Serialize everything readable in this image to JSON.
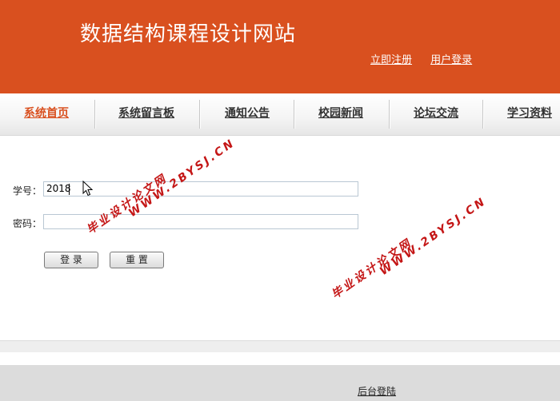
{
  "header": {
    "title": "数据结构课程设计网站",
    "links": [
      "立即注册",
      "用户登录"
    ]
  },
  "nav": {
    "items": [
      "系统首页",
      "系统留言板",
      "通知公告",
      "校园新闻",
      "论坛交流",
      "学习资料"
    ],
    "active_index": 0
  },
  "login_form": {
    "student_id_label": "学号：",
    "student_id_value": "2018",
    "password_label": "密码：",
    "password_value": "",
    "login_button": "登 录",
    "reset_button": "重 置"
  },
  "footer": {
    "admin_login_link": "后台登陆"
  },
  "watermarks": [
    "毕业设计论文网",
    "WWW.2BYSJ.CN",
    "毕业设计论文网",
    "WWW.2BYSJ.CN"
  ],
  "colors": {
    "brand": "#d9501f",
    "nav_active": "#d9501f",
    "watermark": "#c41616",
    "footer_bg": "#dcdcdc"
  },
  "icons": {
    "mouse_cursor": "arrow-cursor-icon"
  }
}
